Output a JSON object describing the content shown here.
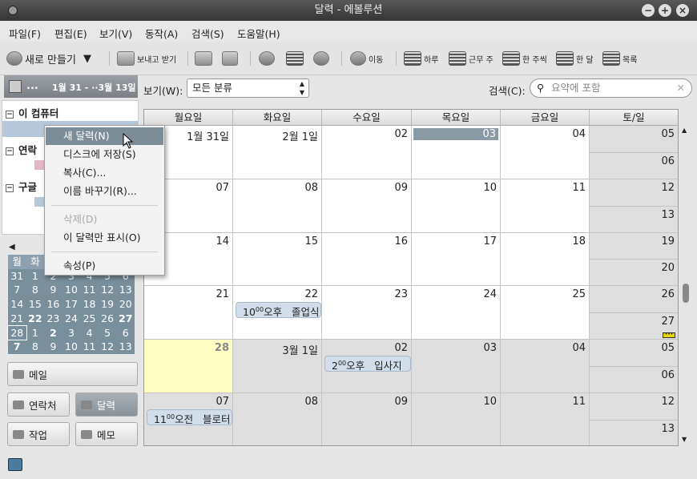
{
  "window": {
    "title": "달력 - 에볼루션"
  },
  "menubar": [
    "파일(F)",
    "편집(E)",
    "보기(V)",
    "동작(A)",
    "검색(S)",
    "도움말(H)"
  ],
  "toolbar": {
    "new_label": "새로 만들기",
    "send_receive": "보내고 받기",
    "goto": "이동",
    "day": "하루",
    "work_week": "근무 주",
    "week": "한 주씩",
    "month": "한 달",
    "list": "목록"
  },
  "sidebar": {
    "header_dots": "...",
    "header_range": "1월 31 - ··3월 13일",
    "groups": [
      "이 컴퓨터",
      "연락",
      "구글"
    ],
    "switcher": [
      {
        "label": "메일",
        "icon": "mail-icon"
      },
      {
        "label": "연락처",
        "icon": "contacts-icon"
      },
      {
        "label": "달력",
        "icon": "calendar-icon",
        "active": true
      },
      {
        "label": "작업",
        "icon": "tasks-icon"
      },
      {
        "label": "메모",
        "icon": "memo-icon"
      }
    ]
  },
  "minical": {
    "headers": [
      "월",
      "화",
      "",
      "",
      "",
      "",
      ""
    ],
    "rows": [
      [
        "31",
        "1",
        "2",
        "3",
        "4",
        "5",
        "6"
      ],
      [
        "7",
        "8",
        "9",
        "10",
        "11",
        "12",
        "13"
      ],
      [
        "14",
        "15",
        "16",
        "17",
        "18",
        "19",
        "20"
      ],
      [
        "21",
        "22",
        "23",
        "24",
        "25",
        "26",
        "27"
      ],
      [
        "28",
        "1",
        "2",
        "3",
        "4",
        "5",
        "6"
      ],
      [
        "7",
        "8",
        "9",
        "10",
        "11",
        "12",
        "13"
      ]
    ]
  },
  "viewbar": {
    "show_label": "보기(W):",
    "category": "모든 분류",
    "search_label": "검색(C):",
    "search_placeholder": "요약에 포함"
  },
  "calendar": {
    "day_headers": [
      "월요일",
      "화요일",
      "수요일",
      "목요일",
      "금요일",
      "토/일"
    ],
    "weeks": [
      {
        "days": [
          "1월 31일",
          "2월  1일",
          "02",
          "03",
          "04"
        ],
        "sat": "05",
        "sun": "06"
      },
      {
        "days": [
          "07",
          "08",
          "09",
          "10",
          "11"
        ],
        "sat": "12",
        "sun": "13"
      },
      {
        "days": [
          "14",
          "15",
          "16",
          "17",
          "18"
        ],
        "sat": "19",
        "sun": "20"
      },
      {
        "days": [
          "21",
          "22",
          "23",
          "24",
          "25"
        ],
        "sat": "26",
        "sun": "27"
      },
      {
        "days": [
          "28",
          "3월  1일",
          "02",
          "03",
          "04"
        ],
        "sat": "05",
        "sun": "06"
      },
      {
        "days": [
          "07",
          "08",
          "09",
          "10",
          "11"
        ],
        "sat": "12",
        "sun": "13"
      }
    ],
    "events": [
      {
        "week": 3,
        "day": 1,
        "hour": "10",
        "minute": "00",
        "ampm": "오후",
        "title": "졸업식"
      },
      {
        "week": 4,
        "day": 2,
        "hour": "2",
        "minute": "00",
        "ampm": "오후",
        "title": "입사지"
      },
      {
        "week": 5,
        "day": 0,
        "hour": "11",
        "minute": "00",
        "ampm": "오전",
        "title": "블로터"
      }
    ]
  },
  "context_menu": [
    {
      "label": "새 달력(N)",
      "hover": true
    },
    {
      "label": "디스크에 저장(S)"
    },
    {
      "label": "복사(C)..."
    },
    {
      "label": "이름 바꾸기(R)..."
    },
    {
      "sep": true
    },
    {
      "label": "삭제(D)",
      "disabled": true
    },
    {
      "label": "이 달력만 표시(O)"
    },
    {
      "sep": true
    },
    {
      "label": "속성(P)"
    }
  ],
  "colors": {
    "accent": "#8a9aa4",
    "today": "#ffffc4",
    "event": "#d1dde8",
    "calendar_swatch": "#b7c8da",
    "contacts_swatch": "#e3b7c6"
  }
}
